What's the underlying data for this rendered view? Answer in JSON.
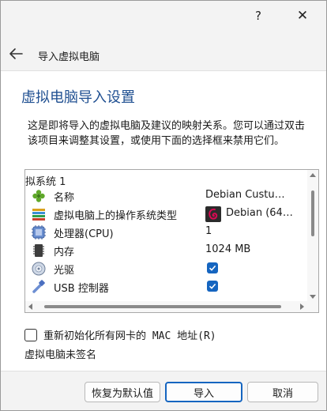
{
  "titlebar": {
    "help_glyph": "?",
    "close_glyph": "✕"
  },
  "nav": {
    "title": "导入虚拟电脑"
  },
  "content": {
    "heading": "虚拟电脑导入设置",
    "description": "这是即将导入的虚拟电脑及建议的映射关系。您可以通过双击该项目来调整其设置，或使用下面的选择框来禁用它们。"
  },
  "tree": {
    "group_label": "拟系统 1",
    "rows": [
      {
        "label": "名称",
        "value": "Debian Custu…",
        "icon": "name-icon"
      },
      {
        "label": "虚拟电脑上的操作系统类型",
        "value": "Debian (64…",
        "icon": "os-type-icon"
      },
      {
        "label": "处理器(CPU)",
        "value": "1",
        "icon": "cpu-icon"
      },
      {
        "label": "内存",
        "value": "1024 MB",
        "icon": "ram-icon"
      },
      {
        "label": "光驱",
        "checked": true,
        "icon": "optical-drive-icon"
      },
      {
        "label": "USB 控制器",
        "checked": true,
        "icon": "usb-icon"
      }
    ]
  },
  "options": {
    "reinit_mac_label": "重新初始化所有网卡的 MAC 地址(R)",
    "reinit_mac_checked": false,
    "signature_status": "虚拟电脑未签名"
  },
  "buttons": {
    "restore_defaults": "恢复为默认值",
    "import": "导入",
    "cancel": "取消"
  },
  "colors": {
    "accent": "#1565c0",
    "heading": "#1f4f91"
  }
}
